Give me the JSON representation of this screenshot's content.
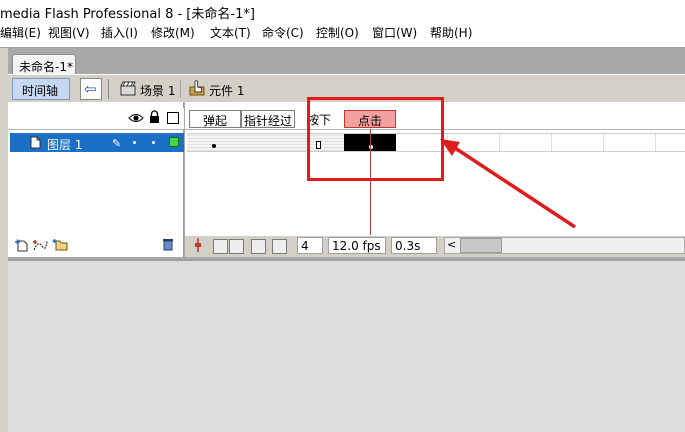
{
  "window": {
    "title": "media Flash Professional 8 - [未命名-1*]"
  },
  "menu": [
    {
      "label": "编辑(E)"
    },
    {
      "label": "视图(V)"
    },
    {
      "label": "插入(I)"
    },
    {
      "label": "修改(M)"
    },
    {
      "label": "文本(T)"
    },
    {
      "label": "命令(C)"
    },
    {
      "label": "控制(O)"
    },
    {
      "label": "窗口(W)"
    },
    {
      "label": "帮助(H)"
    }
  ],
  "document_tab": {
    "label": "未命名-1*"
  },
  "toolbar": {
    "timeline_label": "时间轴",
    "scene_label": "场景 1",
    "symbol_label": "元件 1"
  },
  "layers": [
    {
      "name": "图层 1",
      "color": "#44d644"
    }
  ],
  "frame_labels": {
    "up": "弹起",
    "over": "指针经过",
    "down": "按下",
    "hit": "点击"
  },
  "status": {
    "current_frame": "4",
    "frame_rate": "12.0 fps",
    "elapsed": "0.3s"
  },
  "accent_colors": {
    "selection": "#1b6fc4",
    "hit_label": "#f4a0a0",
    "annotation": "#e11b1b"
  }
}
